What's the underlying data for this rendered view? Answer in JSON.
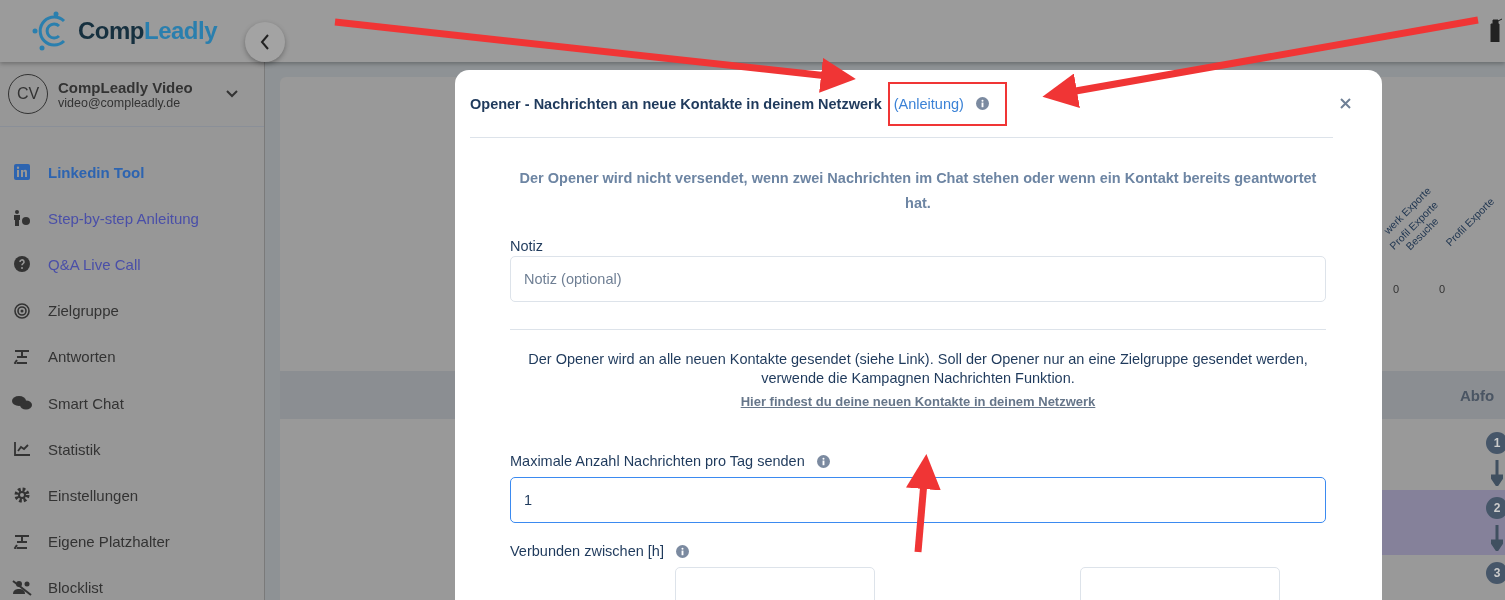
{
  "header": {
    "logo_parts": [
      "Comp",
      "Leadly"
    ]
  },
  "account": {
    "initials": "CV",
    "name": "CompLeadly Video",
    "email": "video@compleadly.de"
  },
  "sidebar": {
    "items": [
      {
        "label": "Linkedin Tool",
        "kind": "linkedin",
        "selected": true
      },
      {
        "label": "Step-by-step Anleitung",
        "kind": "guide",
        "selected": false
      },
      {
        "label": "Q&A Live Call",
        "kind": "help",
        "selected": false
      },
      {
        "label": "Zielgruppe",
        "kind": "target",
        "selected": false
      },
      {
        "label": "Antworten",
        "kind": "reply",
        "selected": false
      },
      {
        "label": "Smart Chat",
        "kind": "chat",
        "selected": false
      },
      {
        "label": "Statistik",
        "kind": "stats",
        "selected": false
      },
      {
        "label": "Einstellungen",
        "kind": "gear",
        "selected": false
      },
      {
        "label": "Eigene Platzhalter",
        "kind": "reply",
        "selected": false
      },
      {
        "label": "Blocklist",
        "kind": "block",
        "selected": false
      }
    ]
  },
  "background": {
    "column_labels": [
      {
        "lines": [
          "werk Exporte"
        ]
      },
      {
        "lines": [
          "Profil Exporte",
          "Besuche"
        ]
      },
      {
        "lines": [
          "Profil Exporte"
        ]
      }
    ],
    "values": [
      "0",
      "0"
    ],
    "table_header": "Abfo",
    "steps": [
      {
        "number": "1",
        "selected": false
      },
      {
        "number": "2",
        "selected": true
      },
      {
        "number": "3",
        "selected": false
      }
    ]
  },
  "modal": {
    "title": "Opener - Nachrichten an neue Kontakte in deinem Netzwerk",
    "title_link": "(Anleitung)",
    "notice": "Der Opener wird nicht versendet, wenn zwei Nachrichten im Chat stehen oder wenn ein Kontakt bereits geantwortet hat.",
    "note_label": "Notiz",
    "note_placeholder": "Notiz (optional)",
    "info": "Der Opener wird an alle neuen Kontakte gesendet (siehe Link). Soll der Opener nur an eine Zielgruppe gesendet werden, verwende die Kampagnen Nachrichten Funktion.",
    "info_link": "Hier findest du deine neuen Kontakte in deinem Netzwerk",
    "max_label": "Maximale Anzahl Nachrichten pro Tag senden",
    "max_value": "1",
    "connected_label": "Verbunden zwischen [h]"
  }
}
